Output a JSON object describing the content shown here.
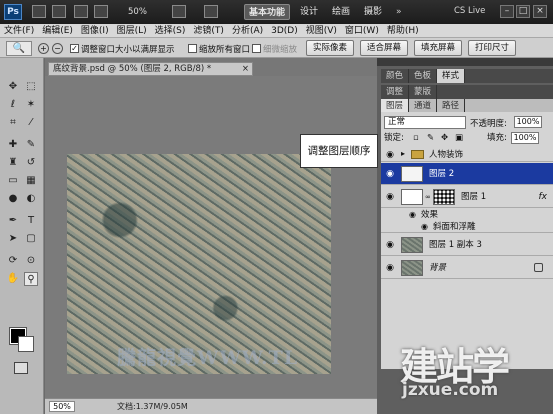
{
  "titlebar": {
    "logo": "Ps",
    "zoom": "50%",
    "workspaces": [
      "基本功能",
      "设计",
      "绘画",
      "摄影"
    ],
    "more": "»",
    "cs_live": "CS Live",
    "window_buttons": [
      "–",
      "□",
      "×"
    ]
  },
  "menubar": {
    "items": [
      "文件(F)",
      "编辑(E)",
      "图像(I)",
      "图层(L)",
      "选择(S)",
      "滤镜(T)",
      "分析(A)",
      "3D(D)",
      "视图(V)",
      "窗口(W)",
      "帮助(H)"
    ]
  },
  "options": {
    "tool": "🔍",
    "zoom_in": "+",
    "zoom_out": "−",
    "resize_windows": "调整窗口大小以满屏显示",
    "zoom_all": "缩放所有窗口",
    "scrubby": "细微缩放",
    "actual_pixels": "实际像素",
    "fit_screen": "适合屏幕",
    "fill_screen": "填充屏幕",
    "print_size": "打印尺寸"
  },
  "document": {
    "tab_title": "底纹背景.psd @ 50% (图层 2, RGB/8) *",
    "close": "×",
    "watermark_text": "騰龍視覺WWW.TL",
    "zoom": "50%",
    "doc_size": "文档:1.37M/9.05M"
  },
  "callout": "调整图层顺序",
  "panels": {
    "top_tabs": [
      "颜色",
      "色板",
      "样式"
    ],
    "adjust_tabs": [
      "调整",
      "蒙版"
    ],
    "layers_tabs": [
      "图层",
      "通道",
      "路径"
    ],
    "blend_mode": "正常",
    "opacity_label": "不透明度:",
    "opacity": "100%",
    "lock_label": "锁定:",
    "fill_label": "填充:",
    "fill": "100%",
    "layers": [
      {
        "name": "人物装饰",
        "type": "group"
      },
      {
        "name": "图层 2",
        "type": "layer",
        "selected": true
      },
      {
        "name": "图层 1",
        "type": "layer",
        "fx": "fx"
      },
      {
        "name": "效果",
        "type": "effects"
      },
      {
        "name": "斜面和浮雕",
        "type": "effect"
      },
      {
        "name": "图层 1 副本 3",
        "type": "layer"
      },
      {
        "name": "背景",
        "type": "background"
      }
    ]
  },
  "site_watermark": {
    "big": "建站学",
    "small": "jzxue.com"
  }
}
